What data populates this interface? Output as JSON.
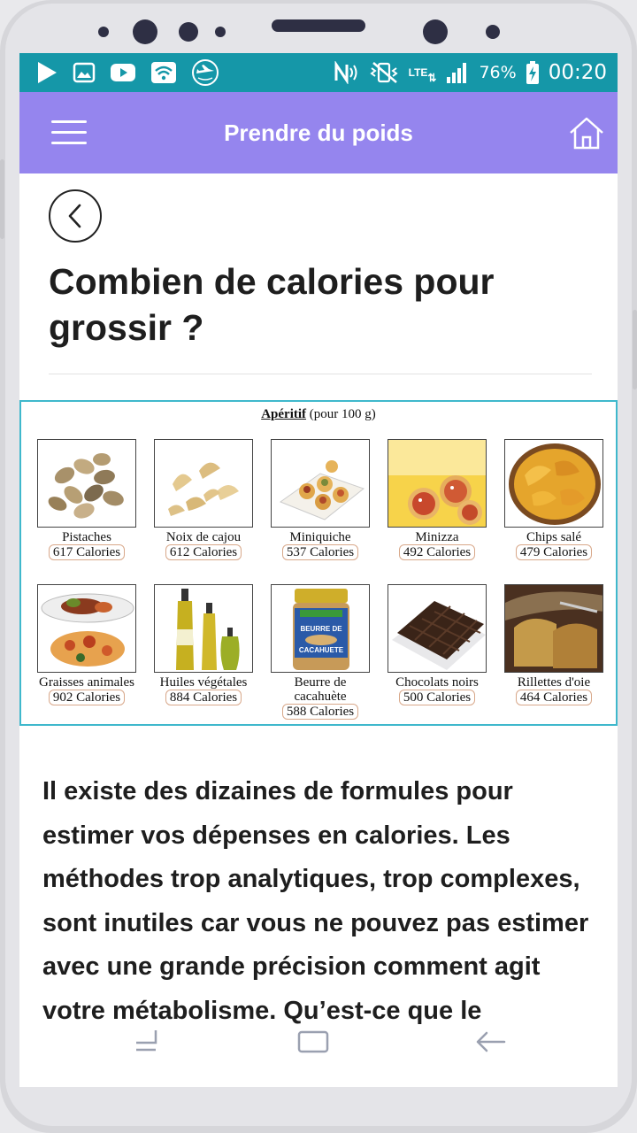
{
  "status_bar": {
    "battery": "76%",
    "time": "00:20",
    "network": "LTE",
    "icons_left": [
      "play-store-icon",
      "gallery-icon",
      "youtube-icon",
      "wifi-hotspot-icon",
      "airplane-app-icon"
    ],
    "icons_right": [
      "nfc-icon",
      "vibrate-icon",
      "lte-icon",
      "signal-icon",
      "battery-charging-icon"
    ]
  },
  "app_bar": {
    "title": "Prendre du poids",
    "background": "#9585ee"
  },
  "article": {
    "title": "Combien de calories pour grossir ?",
    "body": "Il existe des dizaines de formules pour estimer vos dépenses en calories. Les méthodes trop analytiques, trop complexes, sont inutiles car vous ne pouvez pas estimer avec une grande précision comment agit votre métabolisme. Qu’est-ce que le"
  },
  "figure": {
    "title_bold": "Apéritif",
    "title_rest": " (pour 100 g)",
    "foods": [
      {
        "name": "Pistaches",
        "calories": "617 Calories"
      },
      {
        "name": "Noix de cajou",
        "calories": "612 Calories"
      },
      {
        "name": "Miniquiche",
        "calories": "537 Calories"
      },
      {
        "name": "Minizza",
        "calories": "492 Calories"
      },
      {
        "name": "Chips  salé",
        "calories": "479 Calories"
      },
      {
        "name": "Graisses animales",
        "calories": "902 Calories"
      },
      {
        "name": "Huiles végétales",
        "calories": "884 Calories"
      },
      {
        "name": "Beurre de cacahuète",
        "calories": "588 Calories"
      },
      {
        "name": "Chocolats noirs",
        "calories": "500 Calories"
      },
      {
        "name": "Rillettes d'oie",
        "calories": "464 Calories"
      }
    ],
    "jar_label_line1": "BEURRE DE",
    "jar_label_line2": "CACAHUETE"
  },
  "colors": {
    "status_bar": "#1597a8",
    "app_bar": "#9585ee",
    "figure_border": "#3fb8cc"
  }
}
